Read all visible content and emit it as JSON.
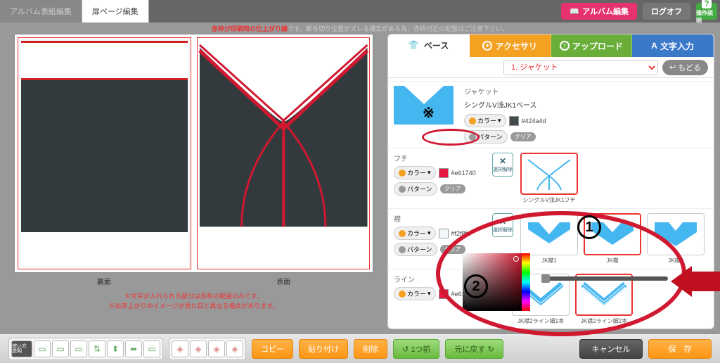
{
  "header": {
    "tab_cover": "アルバム表紙編集",
    "tab_page": "扉ページ編集",
    "btn_album": "アルバム編集",
    "btn_logoff": "ログオフ",
    "btn_help": "操作説明"
  },
  "warning": {
    "red_part": "赤枠が印刷時の仕上がり線",
    "rest": "です。断ち切り位置がズレる場合がある為、赤枠付近の配置はご注意下さい。"
  },
  "canvas": {
    "label_back": "裏面",
    "label_front": "表面",
    "note1": "※文字が入れられる部分は赤枠の範囲のみです。",
    "note2": "※出来上がりのイメージが見た目と異なる場合があります。"
  },
  "rpanel": {
    "tabs": {
      "base": "ベース",
      "accessory": "アクセサリ",
      "upload": "アップロード",
      "text": "文字入力"
    },
    "select_value": "1. ジャケット",
    "back_label": "もどる",
    "sections": {
      "jacket": {
        "title": "ジャケット",
        "subtitle": "シングルV浅JK1ベース",
        "color_label": "カラー",
        "pattern_label": "パターン",
        "hex": "#424a4d",
        "clear": "クリア"
      },
      "fuchi": {
        "title": "フチ",
        "color_label": "カラー",
        "pattern_label": "パターン",
        "hex": "#e61740",
        "clear": "クリア",
        "remove": "選択解除",
        "thumb1": "シングルV浅JK1フチ"
      },
      "eri": {
        "title": "襟",
        "color_label": "カラー",
        "pattern_label": "パターン",
        "hex": "#f2f8fa",
        "clear": "クリア",
        "remove": "選択解除",
        "thumbs": [
          "JK襟1",
          "JK襟",
          "JK襟3"
        ]
      },
      "line": {
        "title": "ライン",
        "color_label": "カラー",
        "hex": "#e61740",
        "thumbs": [
          "JK襟2ライン細1本",
          "JK襟2ライン細2本"
        ]
      }
    }
  },
  "annotations": {
    "star": "※",
    "num1": "1",
    "num2": "2"
  },
  "footer": {
    "info": "使い方\n説明",
    "copy": "コピー",
    "paste": "貼り付け",
    "delete": "削除",
    "undo": "1つ前",
    "redo": "元に戻す",
    "cancel": "キャンセル",
    "save": "保　存"
  }
}
